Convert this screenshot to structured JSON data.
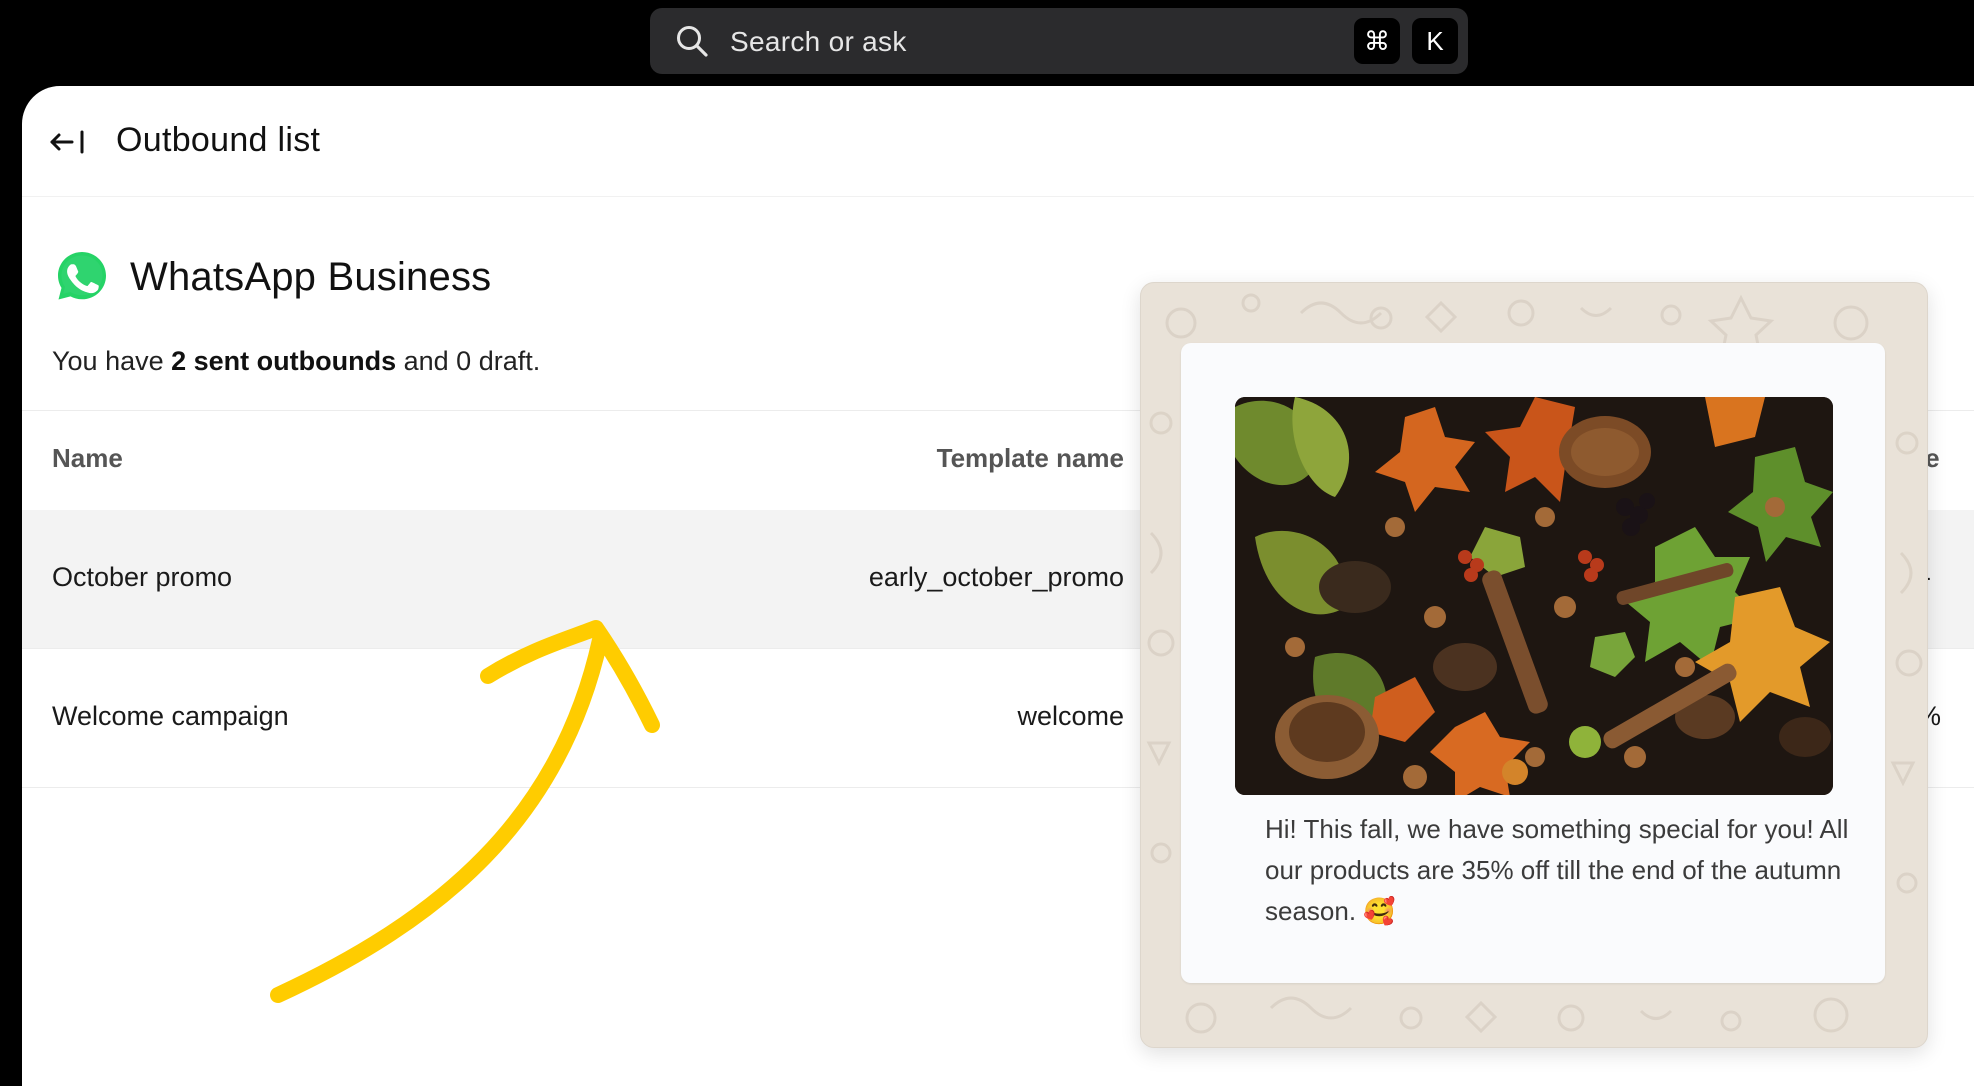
{
  "search": {
    "placeholder": "Search or ask",
    "shortcut_cmd": "⌘",
    "shortcut_key": "K"
  },
  "header": {
    "title": "Outbound list"
  },
  "channel": {
    "name": "WhatsApp Business",
    "brand_color": "#25D366"
  },
  "summary": {
    "prefix": "You have ",
    "sent_count_text": "2 sent outbounds",
    "suffix": " and 0 draft."
  },
  "table": {
    "columns": {
      "name": "Name",
      "template_name": "Template name",
      "partial_right": "ate"
    },
    "rows": [
      {
        "name": "October promo",
        "template": "early_october_promo",
        "right_value": "-"
      },
      {
        "name": "Welcome campaign",
        "template": "welcome",
        "right_value": "%"
      }
    ]
  },
  "preview": {
    "message": "Hi! This fall, we have something special for you! All our products are 35% off till the end of the autumn season. 🥰",
    "bubble_bg": "#fafbfd",
    "chat_bg": "#e9e2d8"
  },
  "annotation": {
    "arrow_color": "#FFCC00"
  }
}
